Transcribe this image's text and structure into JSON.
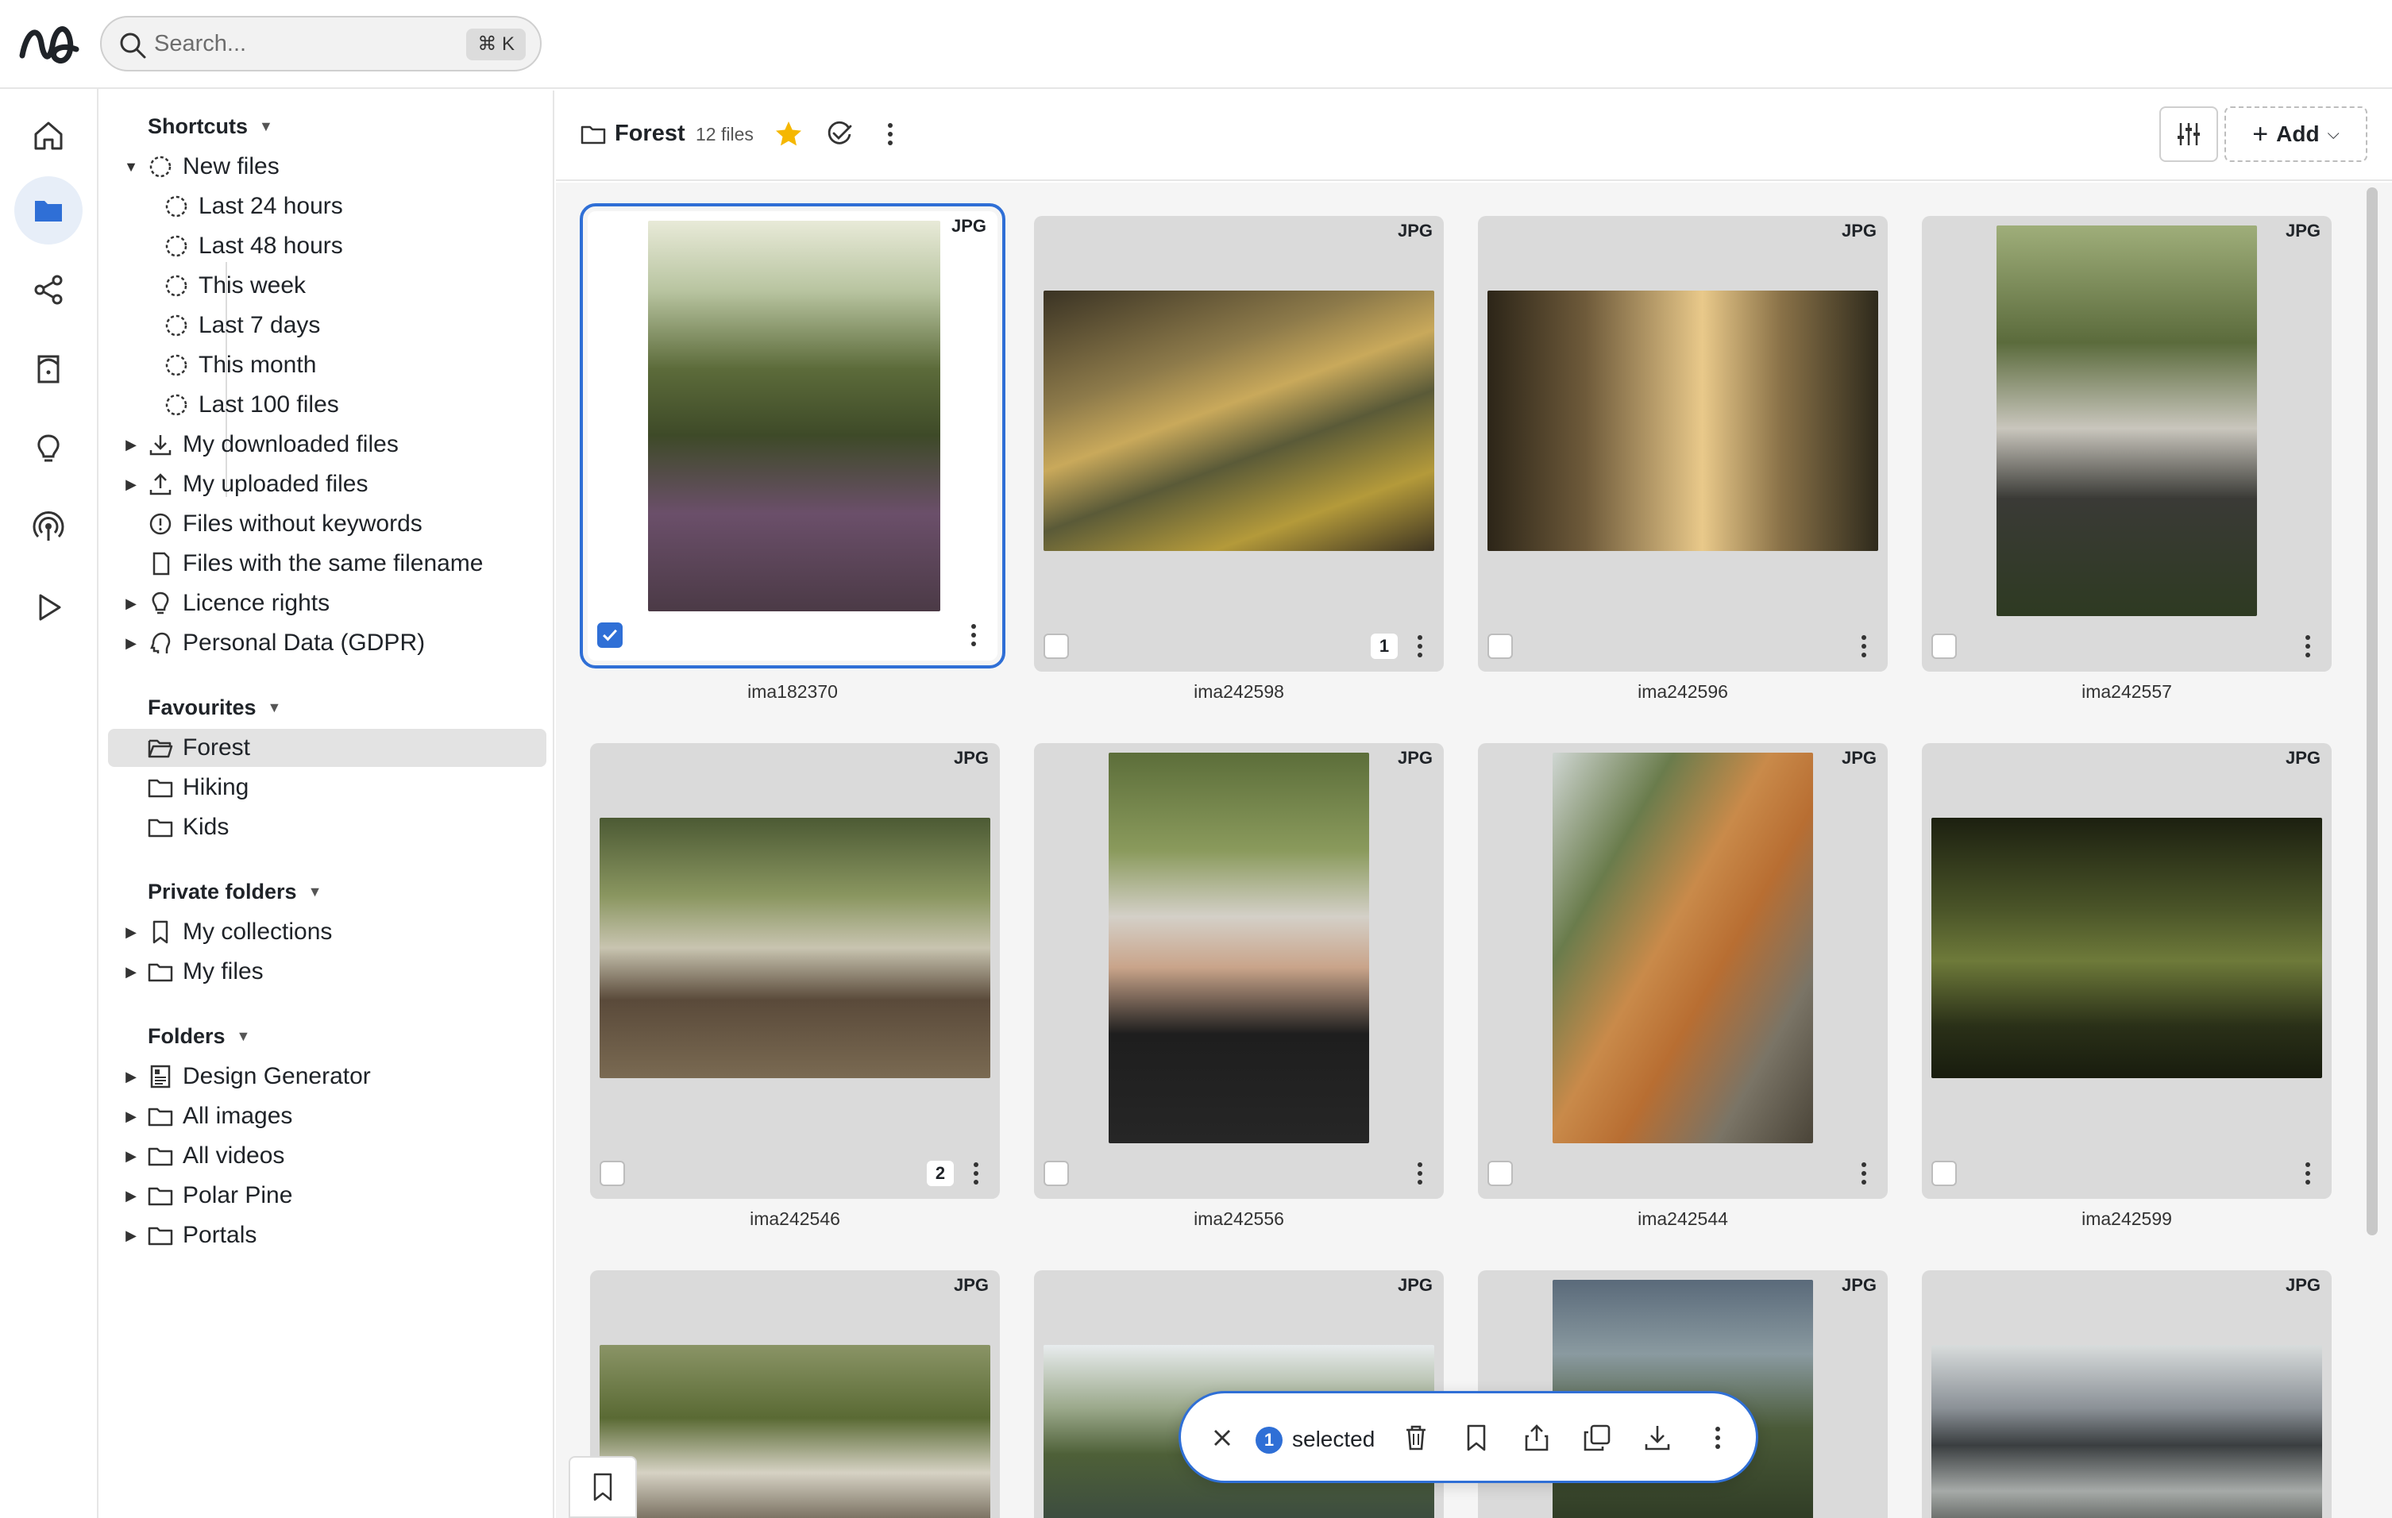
{
  "search": {
    "placeholder": "Search...",
    "shortcut": "⌘ K"
  },
  "rail": [
    {
      "icon": "home-icon"
    },
    {
      "icon": "folder-icon",
      "active": true
    },
    {
      "icon": "share-icon"
    },
    {
      "icon": "tag-icon"
    },
    {
      "icon": "bulb-icon"
    },
    {
      "icon": "broadcast-icon"
    },
    {
      "icon": "play-icon"
    }
  ],
  "tree": {
    "shortcuts": {
      "title": "Shortcuts",
      "new_files": "New files",
      "items": [
        "Last 24 hours",
        "Last 48 hours",
        "This week",
        "Last 7 days",
        "This month",
        "Last 100 files"
      ],
      "downloaded": "My downloaded files",
      "uploaded": "My uploaded files",
      "no_keywords": "Files without keywords",
      "same_filename": "Files with the same filename",
      "licence": "Licence rights",
      "gdpr": "Personal Data (GDPR)"
    },
    "favourites": {
      "title": "Favourites",
      "items": [
        "Forest",
        "Hiking",
        "Kids"
      ]
    },
    "private": {
      "title": "Private folders",
      "items": [
        "My collections",
        "My files"
      ]
    },
    "folders": {
      "title": "Folders",
      "items": [
        "Design Generator",
        "All images",
        "All videos",
        "Polar Pine",
        "Portals"
      ]
    }
  },
  "header": {
    "folder_name": "Forest",
    "file_count": "12 files",
    "add_label": "Add"
  },
  "cards": [
    {
      "name": "ima182370",
      "type": "JPG",
      "selected": true
    },
    {
      "name": "ima242598",
      "type": "JPG",
      "badge": "1"
    },
    {
      "name": "ima242596",
      "type": "JPG"
    },
    {
      "name": "ima242557",
      "type": "JPG"
    },
    {
      "name": "ima242546",
      "type": "JPG",
      "badge": "2"
    },
    {
      "name": "ima242556",
      "type": "JPG"
    },
    {
      "name": "ima242544",
      "type": "JPG"
    },
    {
      "name": "ima242599",
      "type": "JPG"
    },
    {
      "type": "JPG"
    },
    {
      "type": "JPG"
    },
    {
      "type": "JPG"
    },
    {
      "type": "JPG"
    }
  ],
  "selection": {
    "count": "1",
    "label": "selected"
  },
  "colors": {
    "accent": "#2f6fd6",
    "star": "#f5b700"
  }
}
